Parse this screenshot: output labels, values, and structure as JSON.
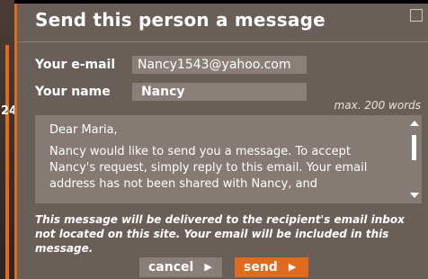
{
  "dialog": {
    "title": "Send this person a message",
    "close_glyph": "☒"
  },
  "form": {
    "email_label": "Your e-mail",
    "email_value": "Nancy1543@yahoo.com",
    "name_label": "Your name",
    "name_value": "Nancy",
    "max_hint": "max. 200 words"
  },
  "message": {
    "greeting": "Dear Maria,",
    "body": "Nancy would like to send you a message. To accept Nancy's request, simply reply to this email. Your email address has not been shared with Nancy, and"
  },
  "disclaimer": "This message will be delivered to the recipient's email inbox not located on this site. Your email will be included in this message.",
  "buttons": {
    "cancel_label": "cancel",
    "send_label": "send",
    "chevron_glyph": "▶"
  },
  "background": {
    "edge_char": "24"
  },
  "colors": {
    "accent": "#e06a1e",
    "dialog_bg": "#6a5f58",
    "field_bg": "#8a7f78"
  }
}
